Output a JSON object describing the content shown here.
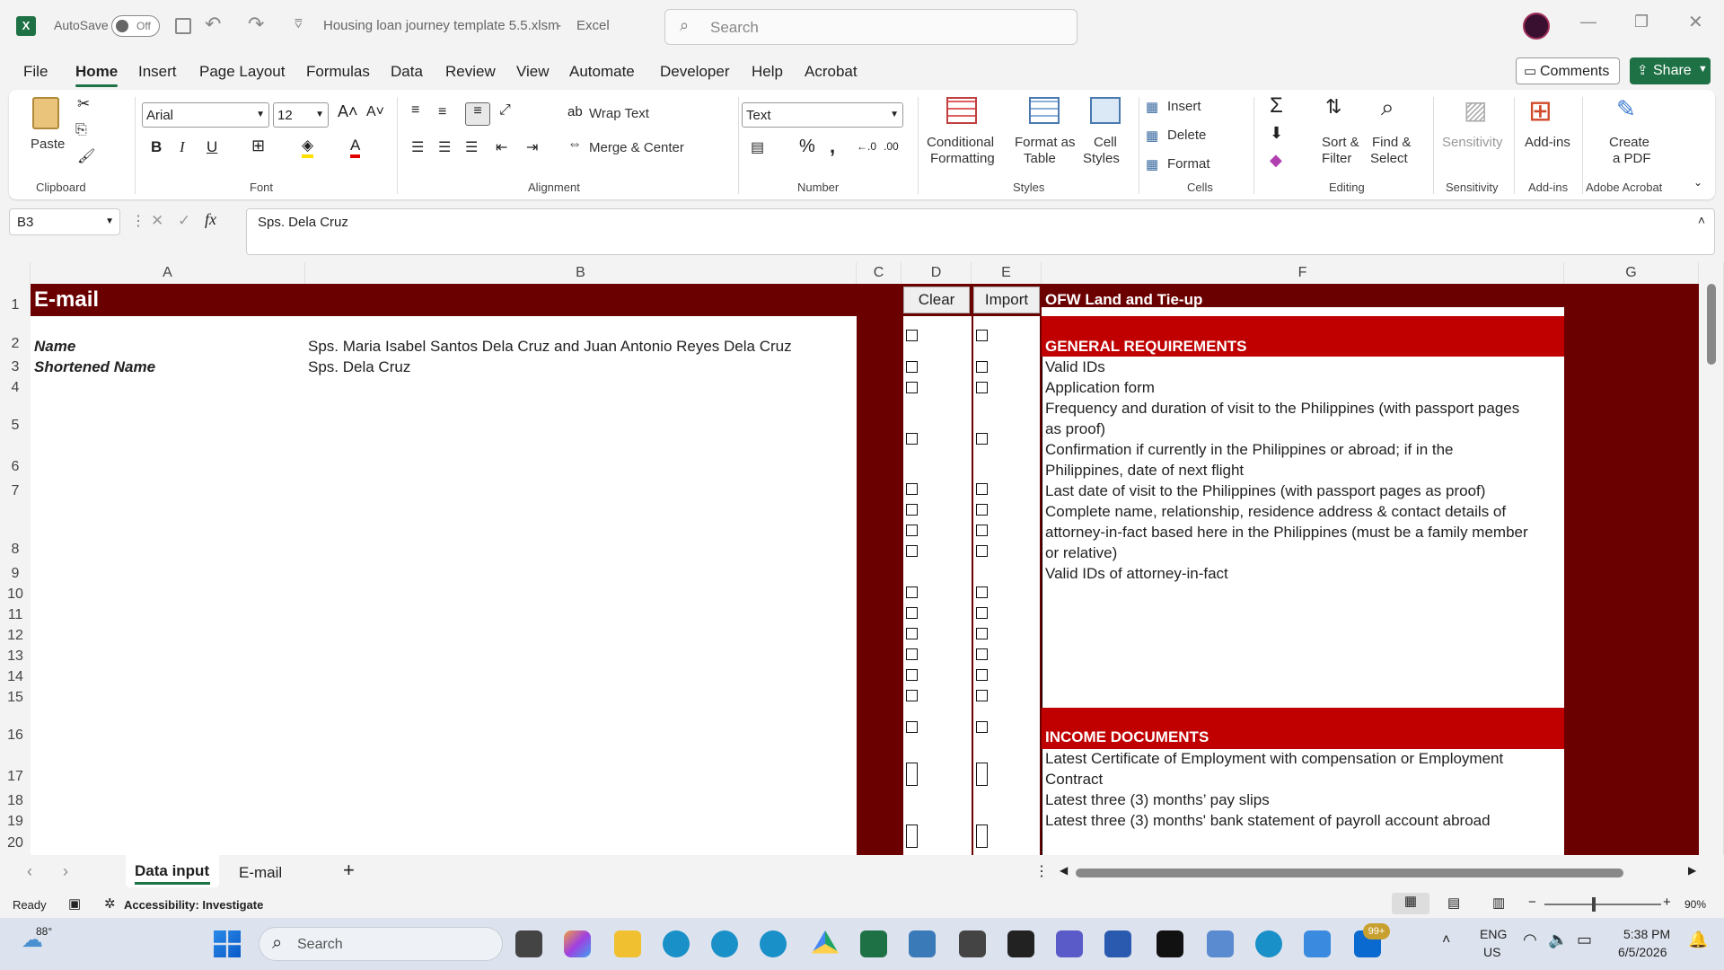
{
  "titlebar": {
    "autosave_label": "AutoSave",
    "autosave_state": "Off",
    "doc_title": "Housing loan journey template 5.5.xlsm",
    "app_name": "Excel",
    "search_placeholder": "Search"
  },
  "menu": {
    "items": [
      "File",
      "Home",
      "Insert",
      "Page Layout",
      "Formulas",
      "Data",
      "Review",
      "View",
      "Automate",
      "Developer",
      "Help",
      "Acrobat"
    ],
    "active": "Home",
    "comments_label": "Comments",
    "share_label": "Share"
  },
  "ribbon": {
    "clipboard": {
      "paste": "Paste",
      "group": "Clipboard"
    },
    "font": {
      "name": "Arial",
      "size": "12",
      "group": "Font"
    },
    "alignment": {
      "wrap": "Wrap Text",
      "merge": "Merge & Center",
      "group": "Alignment"
    },
    "number": {
      "format": "Text",
      "group": "Number"
    },
    "styles": {
      "conditional": "Conditional",
      "conditional2": "Formatting",
      "format_table": "Format as",
      "format_table2": "Table",
      "cell_styles": "Cell",
      "cell_styles2": "Styles",
      "group": "Styles"
    },
    "cells": {
      "insert": "Insert",
      "delete": "Delete",
      "format": "Format",
      "group": "Cells"
    },
    "editing": {
      "sort": "Sort &",
      "sort2": "Filter",
      "find": "Find &",
      "find2": "Select",
      "group": "Editing"
    },
    "sensitivity": {
      "label": "Sensitivity",
      "group": "Sensitivity"
    },
    "addins": {
      "label": "Add-ins",
      "group": "Add-ins"
    },
    "acrobat": {
      "label": "Create",
      "label2": "a PDF",
      "group": "Adobe Acrobat"
    }
  },
  "formula_bar": {
    "cell_ref": "B3",
    "fx": "fx",
    "content": "Sps. Dela Cruz"
  },
  "columns": [
    "A",
    "B",
    "C",
    "D",
    "E",
    "F",
    "G"
  ],
  "rows": [
    "1",
    "2",
    "3",
    "4",
    "5",
    "6",
    "7",
    "8",
    "9",
    "10",
    "11",
    "12",
    "13",
    "14",
    "15",
    "16",
    "17",
    "18",
    "19",
    "20"
  ],
  "sheet": {
    "header_email": "E-mail",
    "name_label": "Name",
    "name_value": "Sps. Maria Isabel Santos Dela Cruz and Juan Antonio Reyes Dela Cruz",
    "short_label": "Shortened Name",
    "short_value": "Sps. Dela Cruz",
    "clear_button": "Clear",
    "import_button": "Import",
    "f_header": "OFW Land and Tie-up",
    "general_req": "GENERAL REQUIREMENTS",
    "general_items": [
      "Valid IDs",
      "Application form",
      "Frequency and duration of visit to the Philippines (with passport pages",
      "as proof)",
      "Confirmation if currently in the Philippines or abroad; if in the",
      "Philippines, date of next flight",
      "Last date of visit to the Philippines (with passport pages as proof)",
      "Complete name, relationship, residence address & contact details of",
      "attorney-in-fact based here in the Philippines (must be a family member",
      "or relative)",
      "Valid IDs of attorney-in-fact"
    ],
    "income_docs": "INCOME DOCUMENTS",
    "income_items": [
      "Latest Certificate of Employment with compensation or Employment",
      "Contract",
      "Latest three (3) months’ pay slips",
      "Latest three (3) months' bank statement of payroll account abroad"
    ]
  },
  "tabs": {
    "items": [
      "Data input",
      "E-mail"
    ],
    "active": "Data input",
    "add": "+"
  },
  "status": {
    "ready": "Ready",
    "accessibility": "Accessibility: Investigate",
    "zoom": "90%"
  },
  "taskbar": {
    "temp": "88°",
    "search": "Search",
    "badge": "99+",
    "lang1": "ENG",
    "lang2": "US",
    "time": "5:38 PM",
    "date": "6/5/2026"
  },
  "colors": {
    "maroon": "#6b0000",
    "red": "#c00000",
    "excel_green": "#1e7145"
  }
}
